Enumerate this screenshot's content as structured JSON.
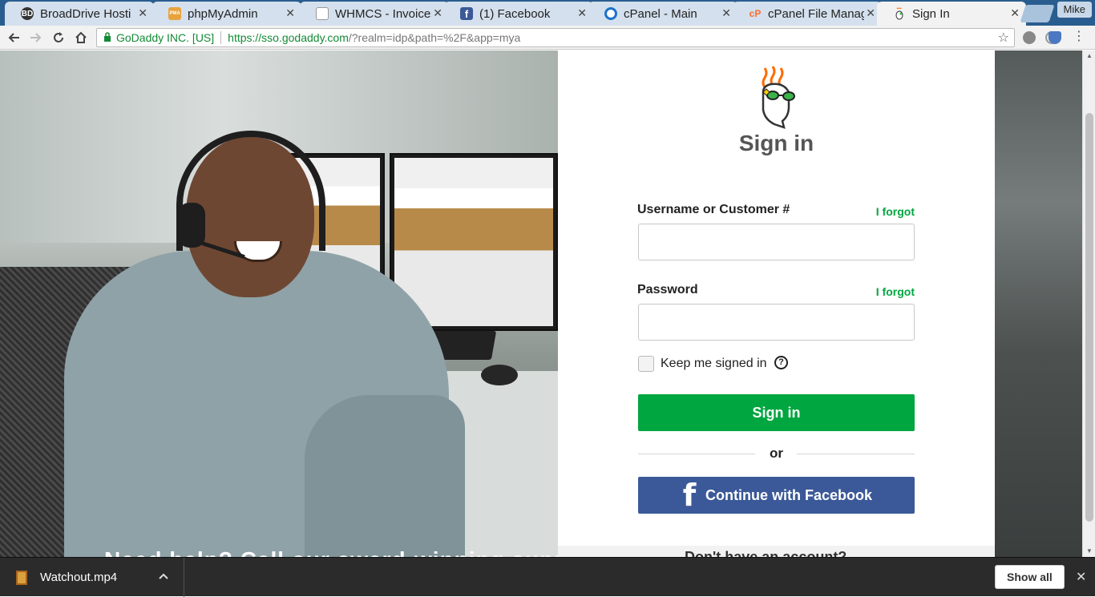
{
  "browser": {
    "tabs": [
      {
        "title": "BroadDrive Hosti",
        "favicon": "BD",
        "favicon_color": "#333333",
        "active": false
      },
      {
        "title": "phpMyAdmin",
        "favicon": "PMA",
        "favicon_color": "#e8a33d",
        "active": false
      },
      {
        "title": "WHMCS - Invoices",
        "favicon": "",
        "favicon_color": "#ffffff",
        "active": false
      },
      {
        "title": "(1) Facebook",
        "favicon": "f",
        "favicon_color": "#3b5998",
        "active": false
      },
      {
        "title": "cPanel - Main",
        "favicon": "",
        "favicon_color": "#1b73c9",
        "active": false
      },
      {
        "title": "cPanel File Manag",
        "favicon": "cP",
        "favicon_color": "#ff6c2c",
        "active": false
      },
      {
        "title": "Sign In",
        "favicon": "",
        "favicon_color": "#e9e9e9",
        "active": true
      }
    ],
    "tab_close_glyph": "✕",
    "profile_name": "Mike",
    "address": {
      "org": "GoDaddy INC. [US]",
      "url_base": "https://sso.godaddy.com",
      "url_rest": "/?realm=idp&path=%2F&app=mya"
    }
  },
  "hero": {
    "caption_peek": "Need help? Call our award-winning support"
  },
  "signin": {
    "title": "Sign in",
    "username_label": "Username or Customer #",
    "username_forgot": "I forgot",
    "username_value": "",
    "password_label": "Password",
    "password_forgot": "I forgot",
    "password_value": "",
    "keep_signed_in_label": "Keep me signed in",
    "keep_signed_in_checked": false,
    "help_glyph": "?",
    "submit_label": "Sign in",
    "or_text": "or",
    "facebook_glyph": "f",
    "facebook_label": "Continue with Facebook",
    "footer_peek": "Don't have an account?"
  },
  "downloads": {
    "file_name": "Watchout.mp4",
    "show_all_label": "Show all"
  },
  "colors": {
    "brand_green": "#00a63f",
    "facebook_blue": "#3b5998",
    "tabstrip": "#2a5d8f"
  }
}
